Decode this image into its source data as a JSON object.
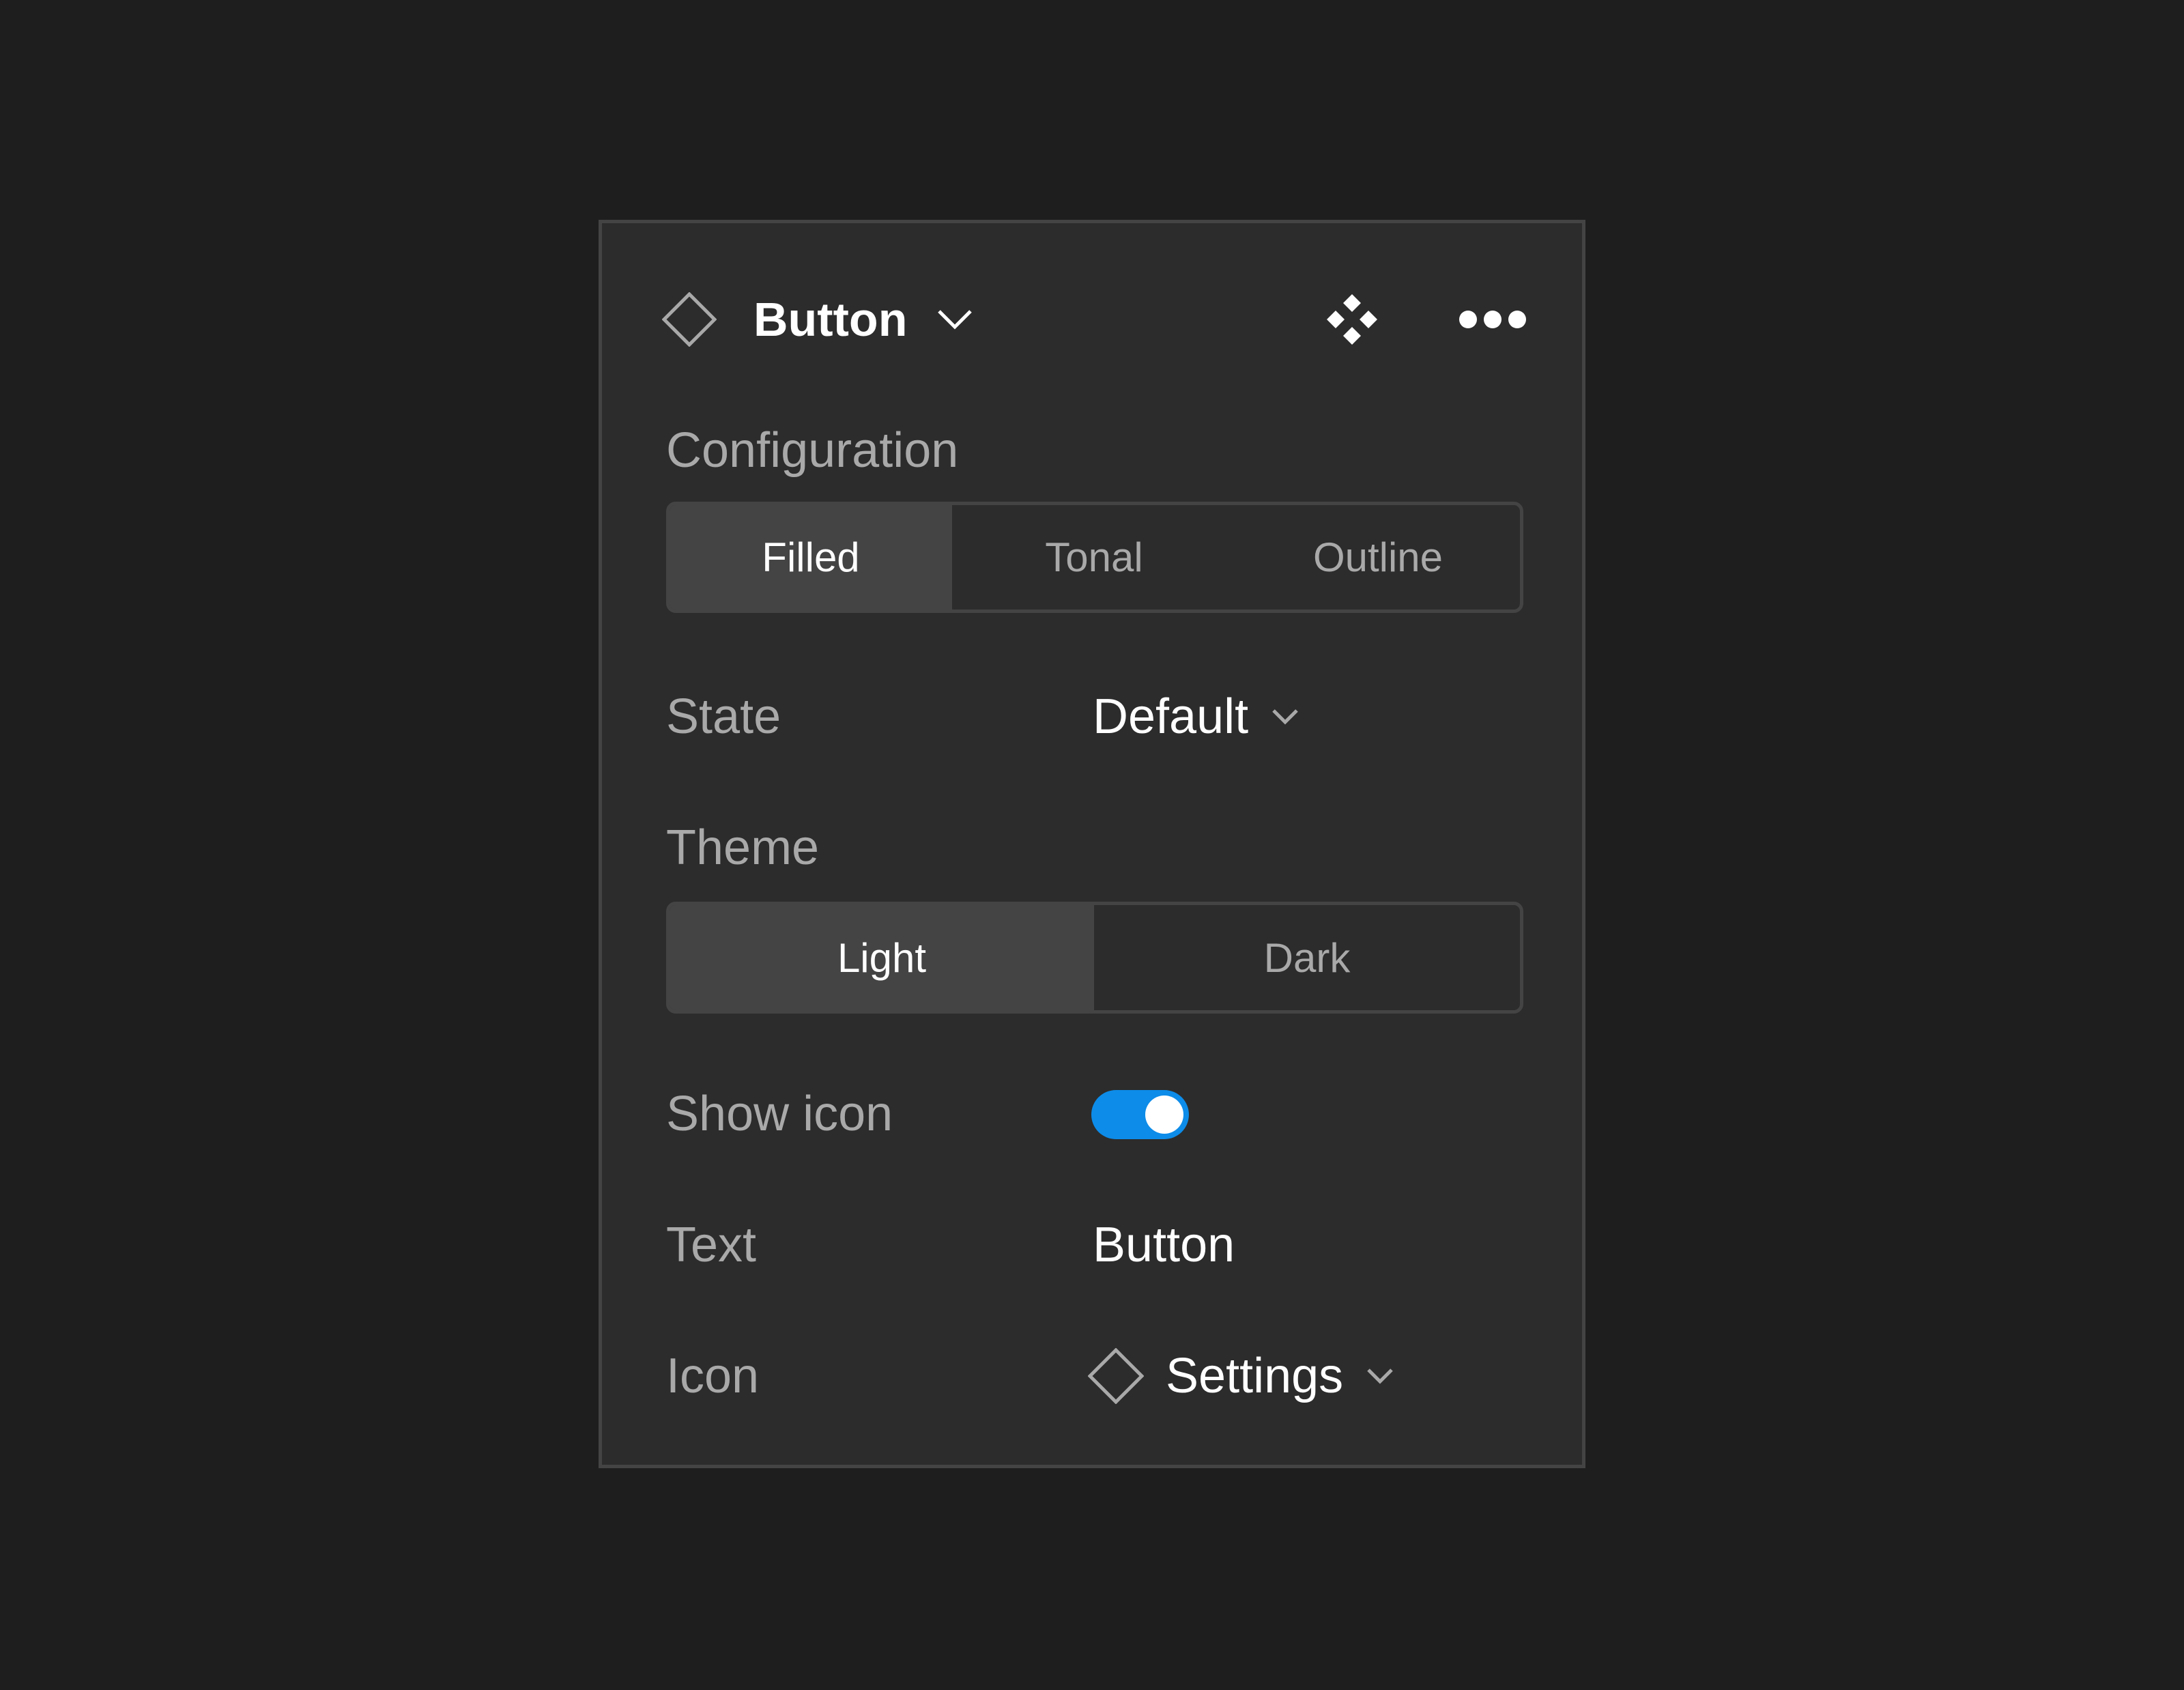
{
  "header": {
    "title": "Button",
    "icon": "diamond-outline-icon",
    "actions": [
      "component-icon",
      "more-icon"
    ]
  },
  "configuration": {
    "label": "Configuration",
    "options": [
      "Filled",
      "Tonal",
      "Outline"
    ],
    "selected": "Filled"
  },
  "state": {
    "label": "State",
    "value": "Default"
  },
  "theme": {
    "label": "Theme",
    "options": [
      "Light",
      "Dark"
    ],
    "selected": "Light"
  },
  "show_icon": {
    "label": "Show icon",
    "on": true
  },
  "text": {
    "label": "Text",
    "value": "Button"
  },
  "icon": {
    "label": "Icon",
    "value": "Settings"
  },
  "colors": {
    "background": "#1e1e1e",
    "panel": "#2c2c2c",
    "border": "#444444",
    "accent": "#0d8ce9",
    "muted_text": "#a9a9a9"
  }
}
